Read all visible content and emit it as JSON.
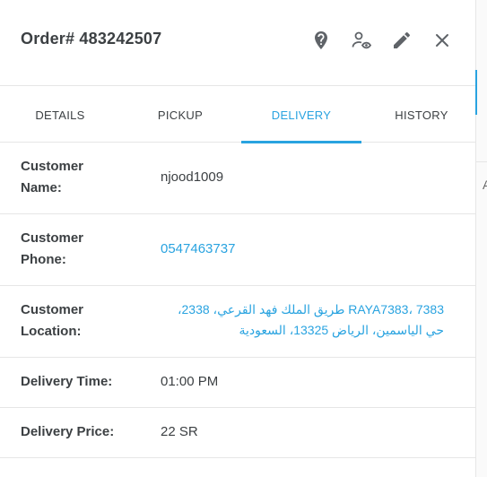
{
  "order": {
    "title": "Order# 483242507"
  },
  "icons": {
    "help": "help-marker-icon",
    "assign": "person-view-icon",
    "edit": "pencil-icon",
    "close": "close-icon"
  },
  "tabs": [
    {
      "label": "DETAILS",
      "active": false
    },
    {
      "label": "PICKUP",
      "active": false
    },
    {
      "label": "DELIVERY",
      "active": true
    },
    {
      "label": "HISTORY",
      "active": false
    }
  ],
  "delivery": {
    "customer_name_label": "Customer Name:",
    "customer_name": "njood1009",
    "customer_phone_label": "Customer Phone:",
    "customer_phone": "0547463737",
    "customer_location_label": "Customer Location:",
    "customer_location": "RAYA7383، 7383 طريق الملك فهد القرعي، 2338، حي الياسمين، الرياض 13325، السعودية",
    "delivery_time_label": "Delivery Time:",
    "delivery_time": "01:00 PM",
    "delivery_price_label": "Delivery Price:",
    "delivery_price": "22 SR"
  },
  "edge": {
    "glyph": "A"
  },
  "colors": {
    "accent": "#29a3e0",
    "text": "#3c4043",
    "divider": "#e6e6e6",
    "icon": "#5f6368"
  }
}
